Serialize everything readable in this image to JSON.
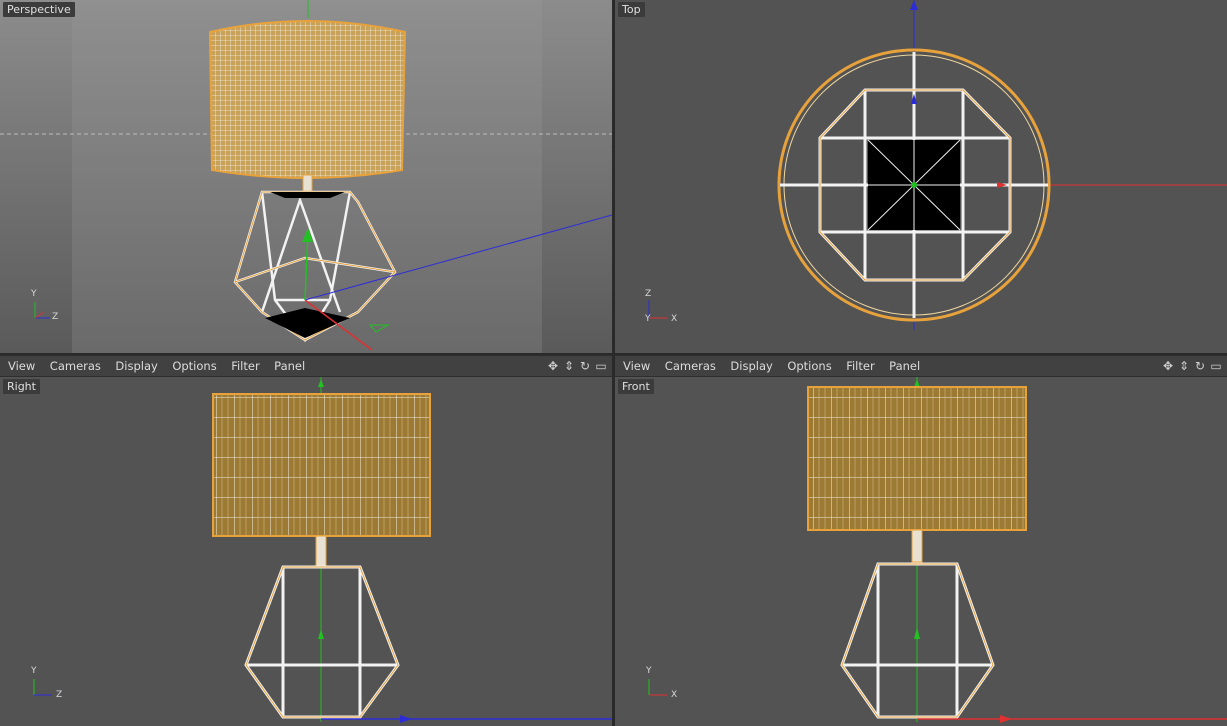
{
  "viewports": {
    "perspective": {
      "label": "Perspective"
    },
    "top": {
      "label": "Top"
    },
    "right": {
      "label": "Right"
    },
    "front": {
      "label": "Front"
    }
  },
  "menu": {
    "items": [
      "View",
      "Cameras",
      "Display",
      "Options",
      "Filter",
      "Panel"
    ]
  },
  "axes": {
    "y": "Y",
    "z": "Z",
    "x": "X"
  },
  "colors": {
    "viewport_bg": "#535353",
    "wire_orange": "#e8a23c",
    "wire_white": "#f2f2f2",
    "axis_x": "#e03030",
    "axis_y": "#22c022",
    "axis_z": "#2d2dd8"
  },
  "icons": [
    "move-icon",
    "pan-icon",
    "rotate-icon",
    "maximize-icon"
  ]
}
